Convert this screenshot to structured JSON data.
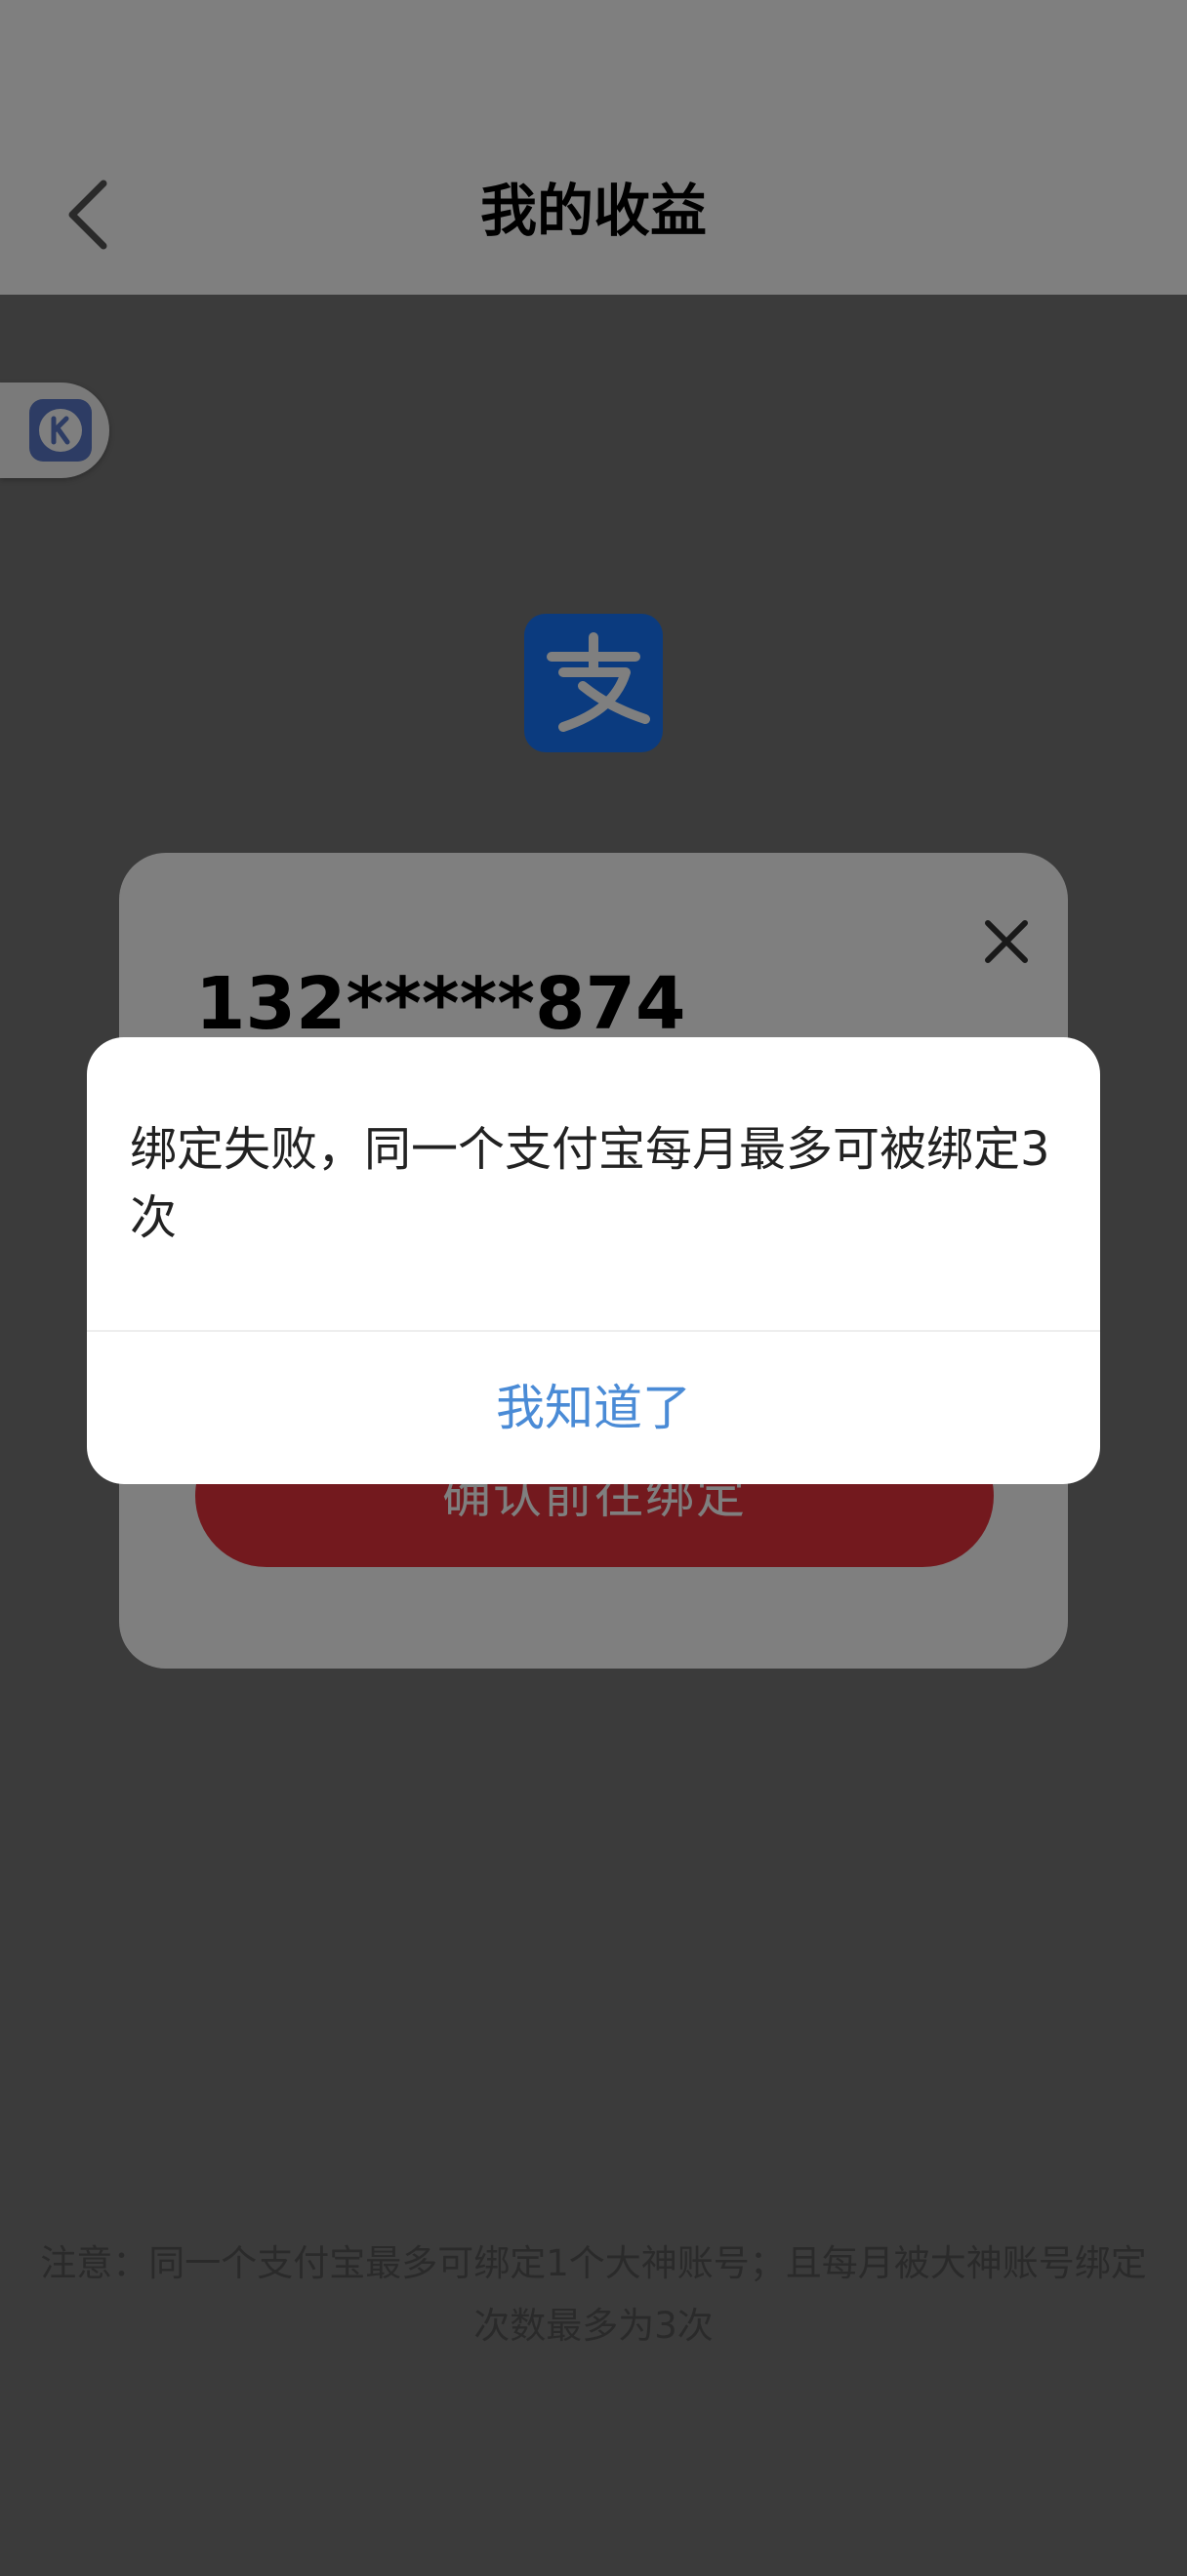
{
  "header": {
    "title": "我的收益",
    "back_icon": "chevron-left-icon"
  },
  "floating_badge": {
    "icon": "k-app-icon"
  },
  "alipay": {
    "icon": "alipay-icon",
    "brand_color": "#1677ff"
  },
  "bind_card": {
    "account": "132*****874",
    "confirm_label": "确认前往绑定",
    "close_icon": "close-icon",
    "button_color": "#e6323c"
  },
  "notice": {
    "text": "注意：同一个支付宝最多可绑定1个大神账号；且每月被大神账号绑定次数最多为3次"
  },
  "dialog": {
    "message": "绑定失败，同一个支付宝每月最多可被绑定3次",
    "ok_label": "我知道了",
    "ok_color": "#4a8bd6"
  }
}
